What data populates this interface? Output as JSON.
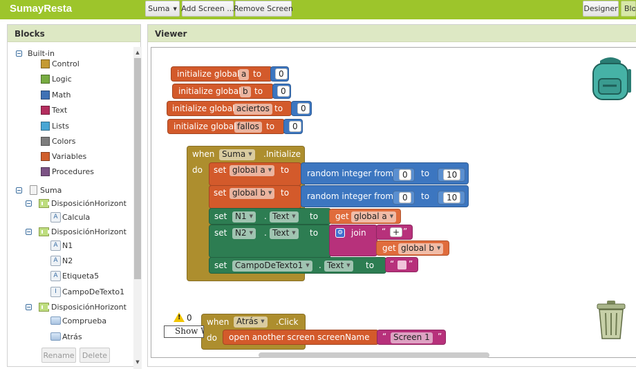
{
  "app": {
    "title": "SumayResta"
  },
  "toolbar": {
    "screen_select": "Suma",
    "add_screen": "Add Screen ...",
    "remove_screen": "Remove Screen",
    "designer": "Designer",
    "blocks": "Blocks"
  },
  "blocks_panel": {
    "title": "Blocks",
    "builtin_label": "Built-in",
    "builtin": [
      {
        "label": "Control",
        "color": "#c49a33"
      },
      {
        "label": "Logic",
        "color": "#77ab41"
      },
      {
        "label": "Math",
        "color": "#3f71b5"
      },
      {
        "label": "Text",
        "color": "#b32d5e"
      },
      {
        "label": "Lists",
        "color": "#49a6d4"
      },
      {
        "label": "Colors",
        "color": "#7d7d7d"
      },
      {
        "label": "Variables",
        "color": "#d05f2d"
      },
      {
        "label": "Procedures",
        "color": "#7c5385"
      }
    ],
    "screen": "Suma",
    "components": {
      "h1": "DisposiciónHorizontal",
      "calcula": "Calcula",
      "h2": "DisposiciónHorizontal",
      "n1": "N1",
      "n2": "N2",
      "etiqueta5": "Etiqueta5",
      "campo": "CampoDeTexto1",
      "h3": "DisposiciónHorizontal",
      "comprueba": "Comprueba",
      "atras": "Atrás"
    },
    "rename": "Rename",
    "delete": "Delete"
  },
  "viewer": {
    "title": "Viewer",
    "warning_count": "0",
    "show_warnings": "Show Warnings",
    "globals": [
      {
        "keyword": "initialize global",
        "name": "a",
        "to": "to",
        "value": "0"
      },
      {
        "keyword": "initialize global",
        "name": "b",
        "to": "to",
        "value": "0"
      },
      {
        "keyword": "initialize global",
        "name": "aciertos",
        "to": "to",
        "value": "0"
      },
      {
        "keyword": "initialize global",
        "name": "fallos",
        "to": "to",
        "value": "0"
      }
    ],
    "event1": {
      "when": "when",
      "component": "Suma",
      "event": ".Initialize",
      "do": "do",
      "set": "set",
      "to": "to",
      "get": "get",
      "dot": ".",
      "global_a": "global a",
      "global_b": "global b",
      "random": "random integer from",
      "from_val": "0",
      "to_val": "10",
      "n1": "N1",
      "n2": "N2",
      "text_prop": "Text",
      "join": "join",
      "plus": "+",
      "campo": "CampoDeTexto1",
      "quote_l": "“",
      "quote_r": "”"
    },
    "event2": {
      "when": "when",
      "component": "Atrás",
      "event": ".Click",
      "do": "do",
      "open": "open another screen  screenName",
      "screen": "Screen 1"
    }
  }
}
